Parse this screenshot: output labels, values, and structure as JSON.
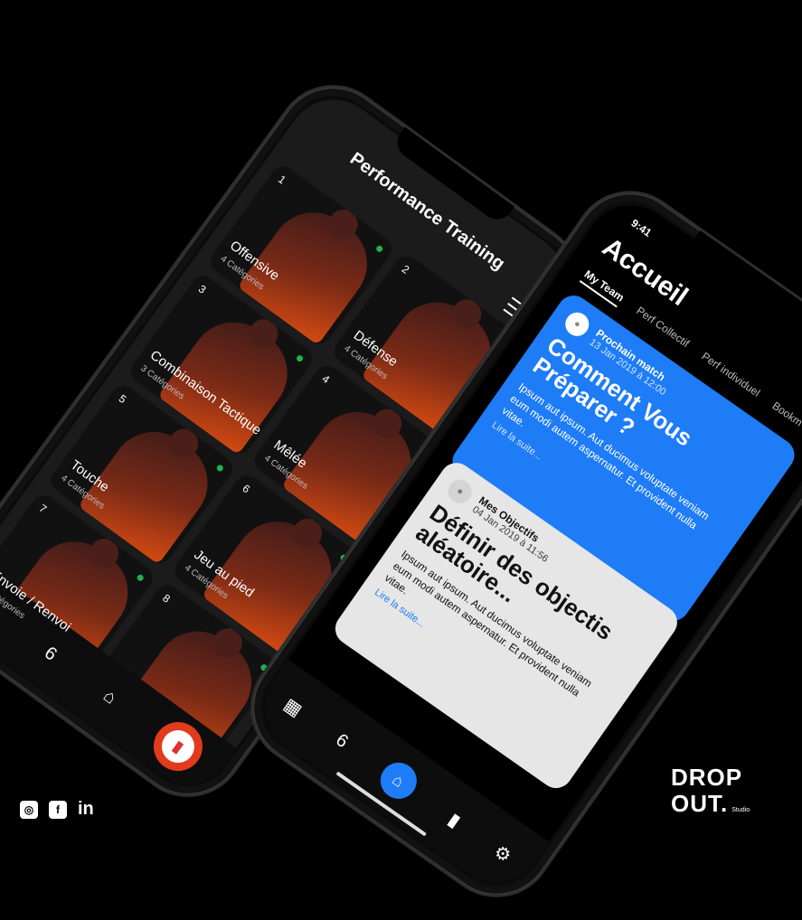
{
  "phone1": {
    "title": "Performance Training",
    "cards": [
      {
        "num": "1",
        "name": "Offensive",
        "sub": "4 Catégories"
      },
      {
        "num": "2",
        "name": "Défense",
        "sub": "4 Catégories"
      },
      {
        "num": "3",
        "name": "Combinaison Tactique",
        "sub": "3 Catégories"
      },
      {
        "num": "4",
        "name": "Mêlée",
        "sub": "4 Catégories"
      },
      {
        "num": "5",
        "name": "Touche",
        "sub": "4 Catégories"
      },
      {
        "num": "6",
        "name": "Jeu au pied",
        "sub": "4 Catégories"
      },
      {
        "num": "7",
        "name": "Envoie / Renvoi",
        "sub": "4 Catégories"
      },
      {
        "num": "8",
        "name": "",
        "sub": ""
      }
    ],
    "nav": {
      "calendar": "▦",
      "brand": "6",
      "home": "⌂",
      "stats": "▮"
    }
  },
  "phone2": {
    "time": "9:41",
    "title": "Accueil",
    "tabs": [
      "My Team",
      "Perf Collectif",
      "Perf individuel",
      "Bookm"
    ],
    "cards": [
      {
        "label": "Prochain match",
        "date": "13 Jan 2019 à 12:00",
        "title": "Comment Vous Préparer ?",
        "body": "Ipsum aut ipsum. Aut ducimus voluptate veniam eum modi autem aspernatur. Et provident nulla vitae.",
        "link": "Lire la suite..."
      },
      {
        "label": "Mes Objectifs",
        "date": "04 Jan 2019 à 11:56",
        "title": "Définir des objectis aléatoire...",
        "body": "Ipsum aut ipsum. Aut ducimus voluptate veniam eum modi autem aspernatur. Et provident nulla vitae.",
        "link": "Lire la suite..."
      }
    ],
    "nav": {
      "calendar": "▦",
      "brand": "6",
      "home": "⌂",
      "stats": "▮",
      "settings": "⚙"
    }
  },
  "branding": {
    "social_ig": "◎",
    "social_fb": "f",
    "social_in": "in",
    "logo_line1": "DROP",
    "logo_line2": "OUT.",
    "logo_sub": "Studio"
  },
  "colors": {
    "accent_blue": "#1e7cf7",
    "accent_red": "#e23a1c",
    "status_green": "#22b14c"
  }
}
